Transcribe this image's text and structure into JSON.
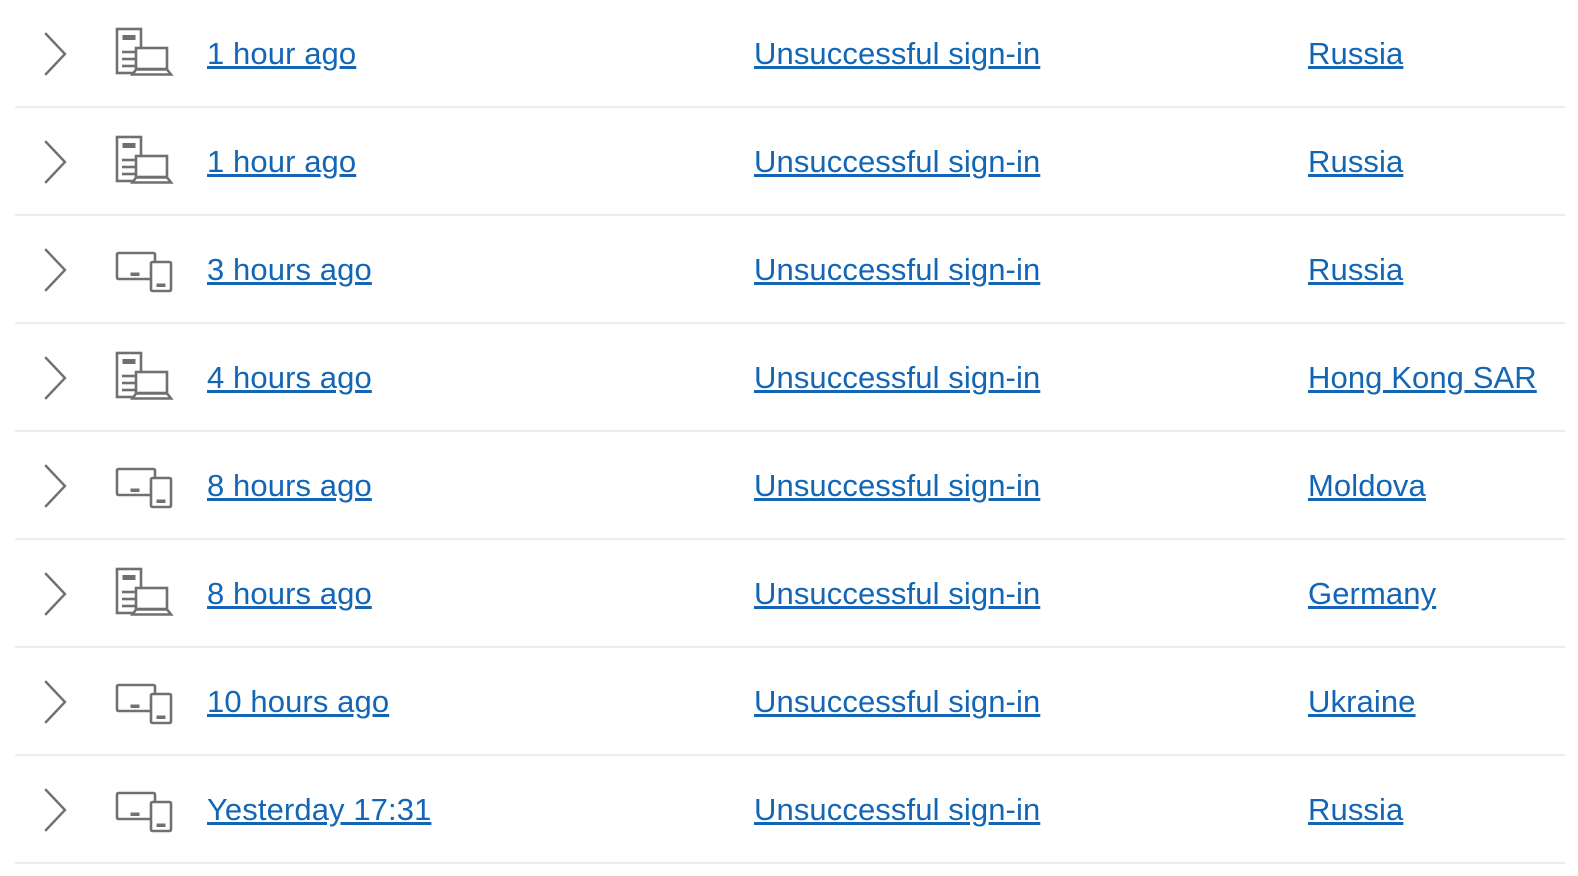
{
  "theme": {
    "link_color": "#1266b5",
    "icon_color": "#707070",
    "divider_color": "#ededed",
    "background": "#ffffff"
  },
  "activity_list": {
    "name": "recent-activity-list",
    "rows": [
      {
        "expander": "chevron-right",
        "device_icon": "desktop-and-laptop",
        "time": "1 hour ago",
        "activity": "Unsuccessful sign-in",
        "location": "Russia"
      },
      {
        "expander": "chevron-right",
        "device_icon": "desktop-and-laptop",
        "time": "1 hour ago",
        "activity": "Unsuccessful sign-in",
        "location": "Russia"
      },
      {
        "expander": "chevron-right",
        "device_icon": "monitor-and-phone",
        "time": "3 hours ago",
        "activity": "Unsuccessful sign-in",
        "location": "Russia"
      },
      {
        "expander": "chevron-right",
        "device_icon": "desktop-and-laptop",
        "time": "4 hours ago",
        "activity": "Unsuccessful sign-in",
        "location": "Hong Kong SAR"
      },
      {
        "expander": "chevron-right",
        "device_icon": "monitor-and-phone",
        "time": "8 hours ago",
        "activity": "Unsuccessful sign-in",
        "location": "Moldova"
      },
      {
        "expander": "chevron-right",
        "device_icon": "desktop-and-laptop",
        "time": "8 hours ago",
        "activity": "Unsuccessful sign-in",
        "location": "Germany"
      },
      {
        "expander": "chevron-right",
        "device_icon": "monitor-and-phone",
        "time": "10 hours ago",
        "activity": "Unsuccessful sign-in",
        "location": "Ukraine"
      },
      {
        "expander": "chevron-right",
        "device_icon": "monitor-and-phone",
        "time": "Yesterday 17:31",
        "activity": "Unsuccessful sign-in",
        "location": "Russia"
      }
    ]
  }
}
